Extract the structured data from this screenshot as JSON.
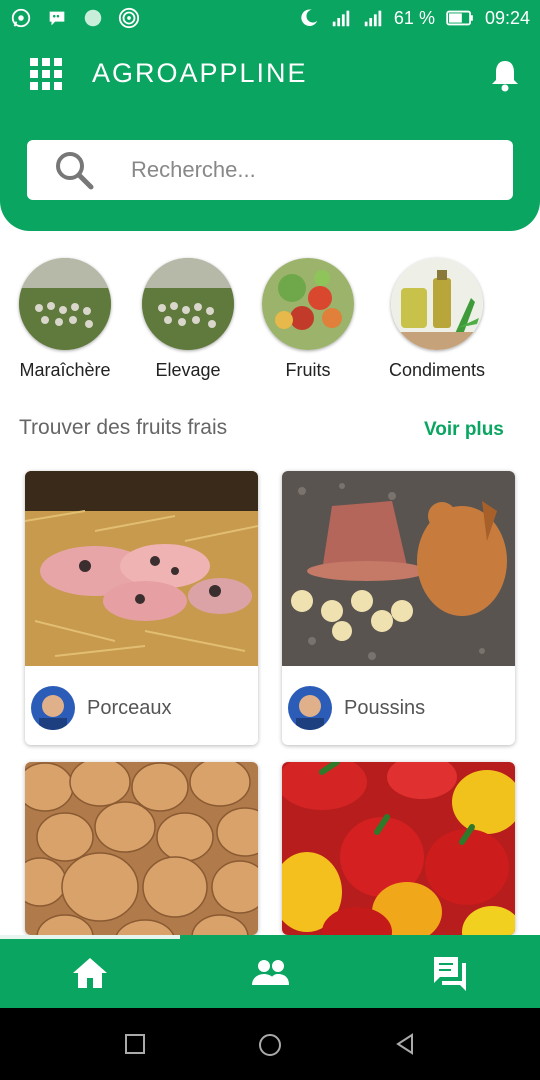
{
  "status_bar": {
    "battery": "61 %",
    "time": "09:24",
    "icons": [
      "whatsapp-icon",
      "message-icon",
      "circle-icon",
      "hotspot-icon",
      "moon-icon",
      "signal-icon",
      "signal-icon",
      "battery-icon"
    ]
  },
  "header": {
    "app_title": "AGROAPPLINE",
    "search_placeholder": "Recherche..."
  },
  "categories": [
    {
      "label": "Maraîchère"
    },
    {
      "label": "Elevage"
    },
    {
      "label": "Fruits"
    },
    {
      "label": "Condiments"
    }
  ],
  "section": {
    "title": "Trouver des fruits frais",
    "link": "Voir plus"
  },
  "cards": [
    {
      "name": "Porceaux"
    },
    {
      "name": "Poussins"
    },
    {
      "name": ""
    },
    {
      "name": ""
    }
  ],
  "bottom_nav": {
    "items": [
      "home-icon",
      "people-icon",
      "chat-icon"
    ]
  },
  "colors": {
    "primary": "#0aa561"
  }
}
